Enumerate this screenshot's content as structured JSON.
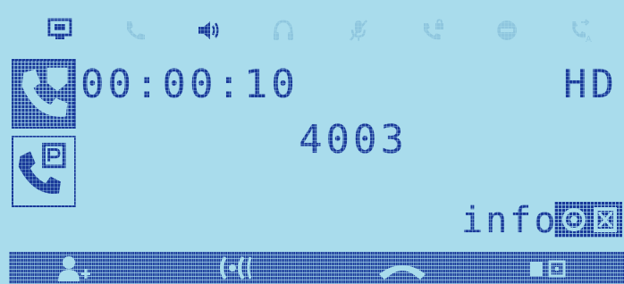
{
  "status_bar": {
    "icons": [
      {
        "name": "network-icon",
        "state": "active"
      },
      {
        "name": "phone-icon",
        "state": "inactive"
      },
      {
        "name": "speaker-icon",
        "state": "active"
      },
      {
        "name": "headset-icon",
        "state": "inactive"
      },
      {
        "name": "mute-mic-icon",
        "state": "inactive"
      },
      {
        "name": "call-lock-icon",
        "state": "inactive"
      },
      {
        "name": "dnd-icon",
        "state": "inactive"
      },
      {
        "name": "auto-answer-icon",
        "state": "inactive"
      }
    ]
  },
  "call": {
    "duration": "00:00:10",
    "quality": "HD",
    "number": "4003",
    "info_label": "info"
  },
  "side_icons": [
    {
      "name": "active-call-icon"
    },
    {
      "name": "parked-call-icon"
    }
  ],
  "softkeys": [
    {
      "name": "add-contact-icon"
    },
    {
      "name": "hold-call-icon"
    },
    {
      "name": "end-call-icon"
    },
    {
      "name": "more-options-icon"
    }
  ],
  "colors": {
    "lcd_background": "#a9dcec",
    "lcd_foreground": "#1a3a9a",
    "inactive_icon": "#8fc6de"
  }
}
